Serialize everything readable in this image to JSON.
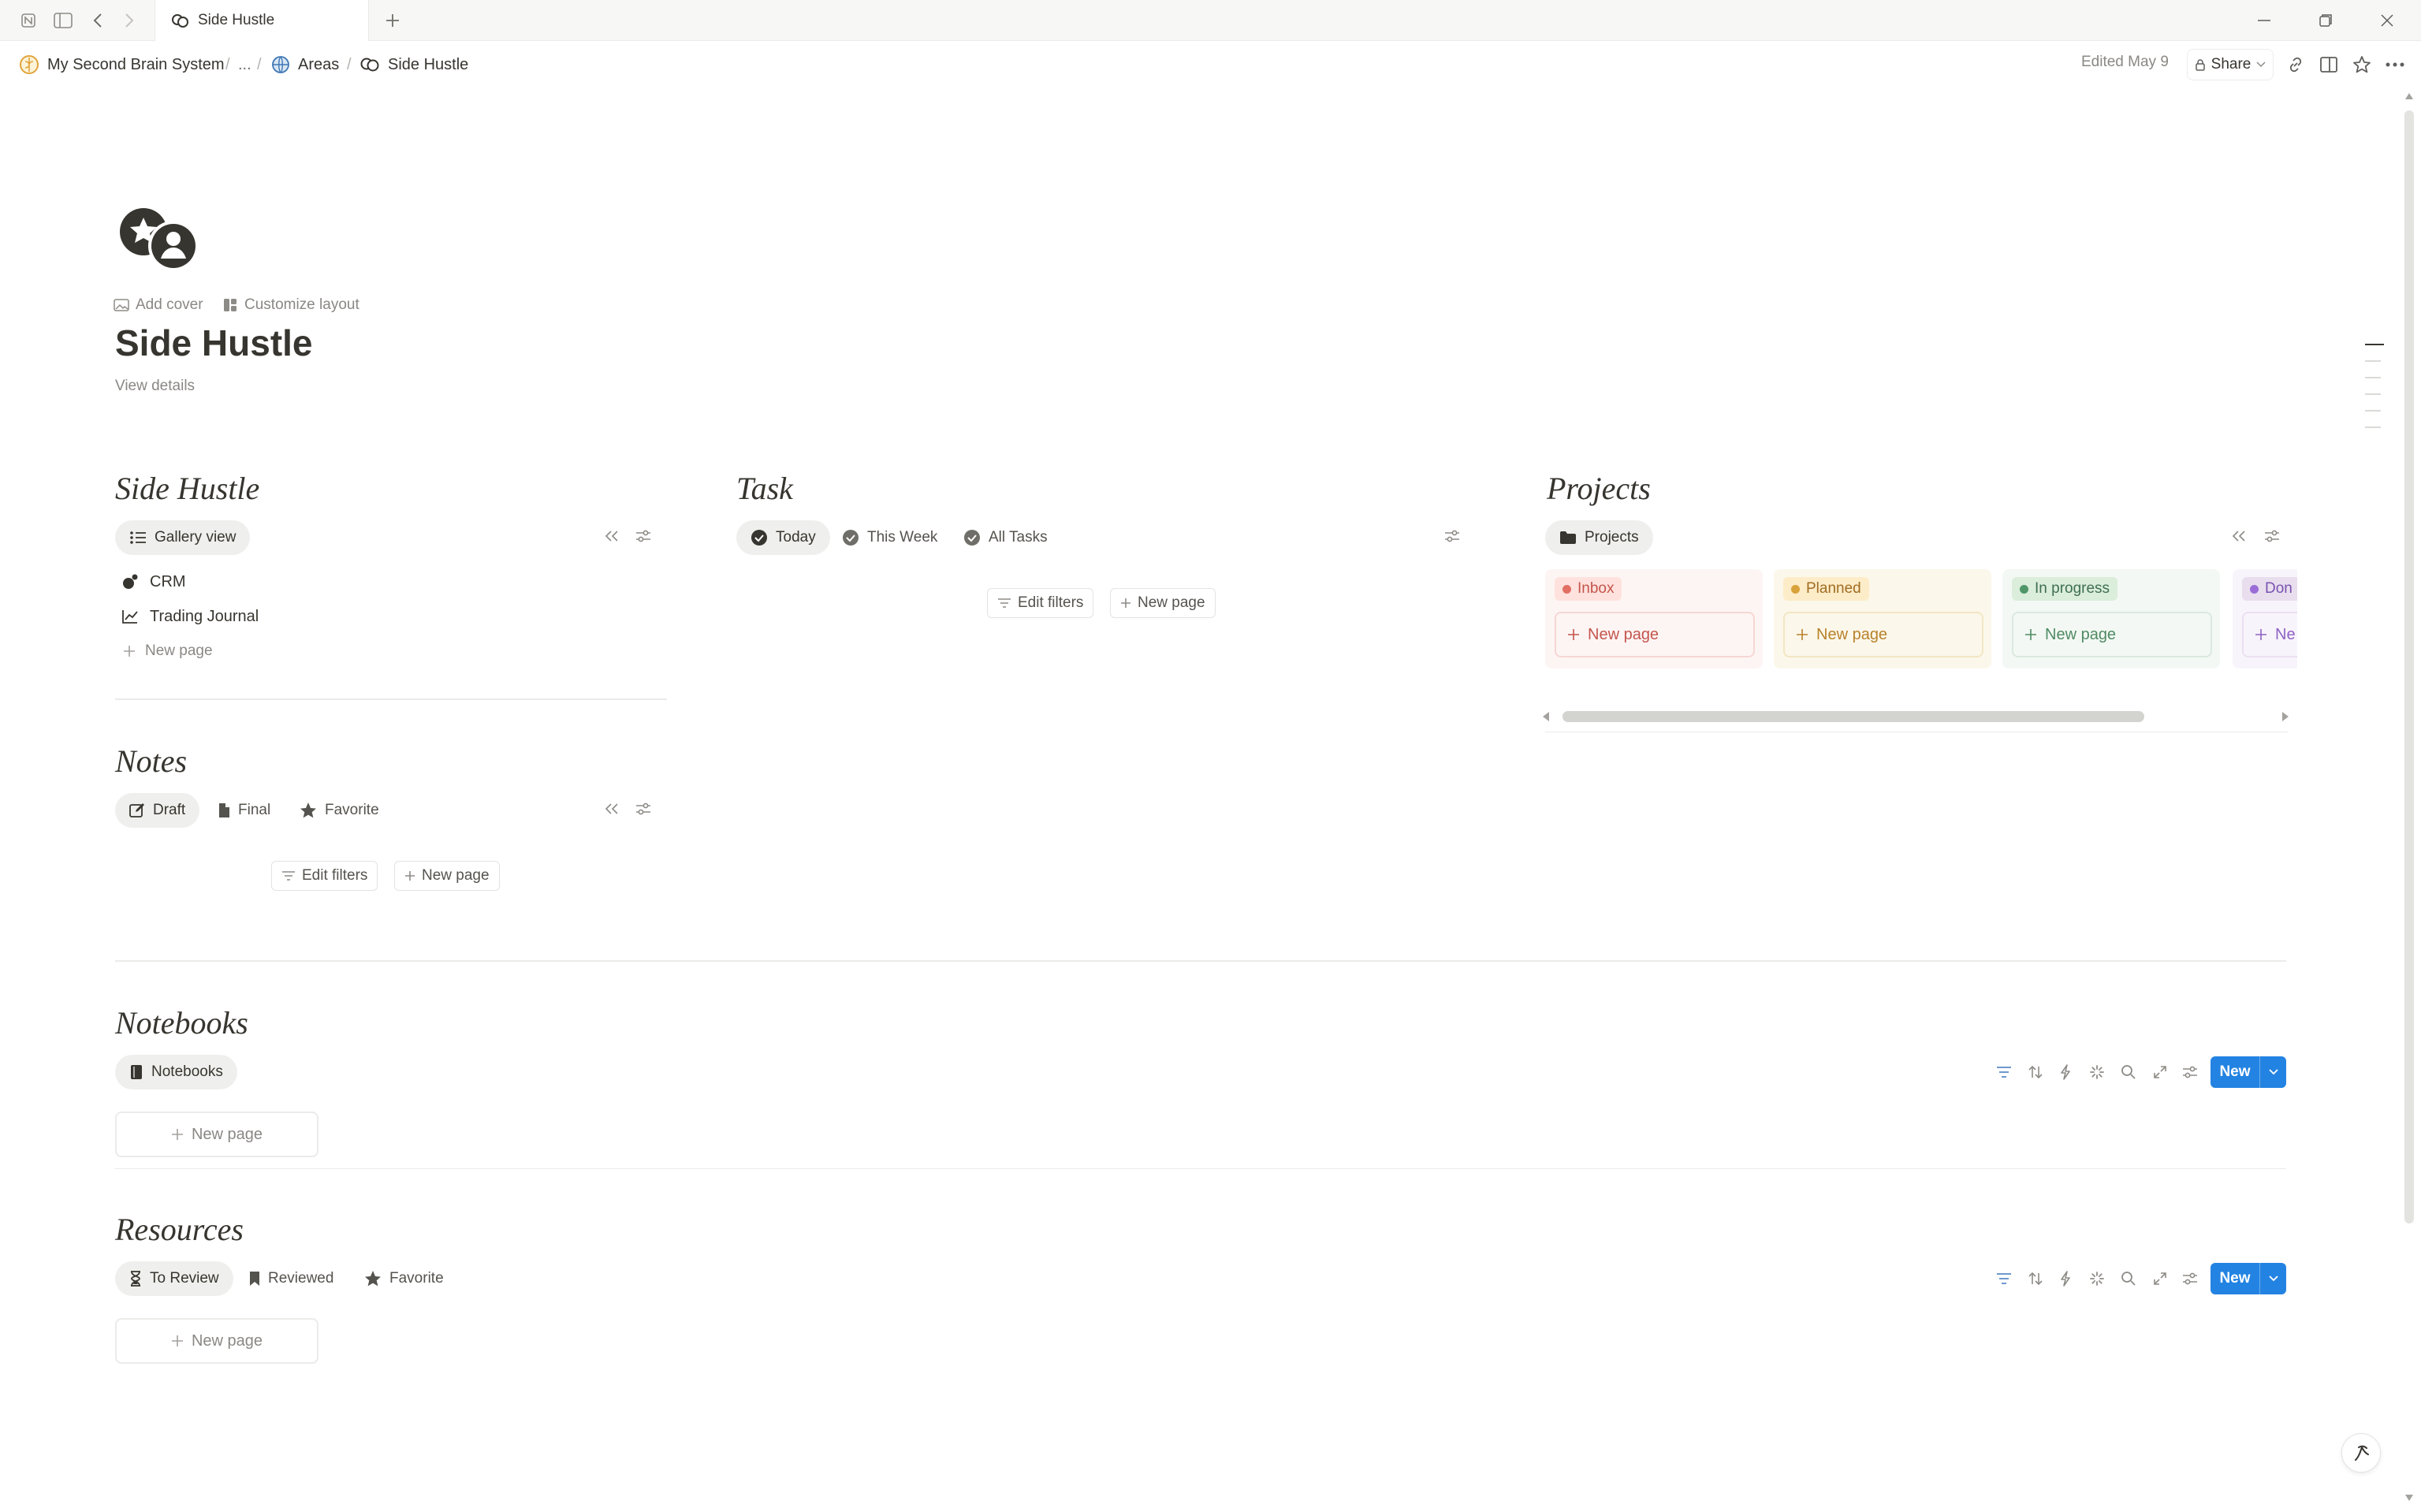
{
  "tab": {
    "title": "Side Hustle"
  },
  "breadcrumb": {
    "items": [
      "My Second Brain System",
      "...",
      "Areas",
      "Side Hustle"
    ],
    "separator": "/"
  },
  "topbar": {
    "edited": "Edited May 9",
    "share": "Share"
  },
  "page": {
    "add_cover": "Add cover",
    "customize_layout": "Customize layout",
    "title": "Side Hustle",
    "view_details": "View details"
  },
  "side_hustle": {
    "title": "Side Hustle",
    "view": "Gallery view",
    "items": [
      "CRM",
      "Trading Journal"
    ],
    "new_page": "New page"
  },
  "task": {
    "title": "Task",
    "tabs": [
      "Today",
      "This Week",
      "All Tasks"
    ],
    "edit_filters": "Edit filters",
    "new_page": "New page"
  },
  "projects": {
    "title": "Projects",
    "view": "Projects",
    "columns": [
      {
        "label": "Inbox",
        "dot": "#e16f64",
        "tag_bg": "#ffe2dd",
        "col_bg": "#fdf5f4",
        "text": "#c4554d"
      },
      {
        "label": "Planned",
        "dot": "#d9a23a",
        "tag_bg": "#fdecc8",
        "col_bg": "#fbf7ea",
        "text": "#b8822b"
      },
      {
        "label": "In progress",
        "dot": "#4f9768",
        "tag_bg": "#dbeddb",
        "col_bg": "#f3f8f4",
        "text": "#4f8a63"
      },
      {
        "label": "Don",
        "dot": "#9a6dd7",
        "tag_bg": "#e8deee",
        "col_bg": "#f8f4fb",
        "text": "#8e62c4"
      }
    ],
    "new_page": "New page",
    "new_page_short": "Ne"
  },
  "notes": {
    "title": "Notes",
    "tabs": [
      "Draft",
      "Final",
      "Favorite"
    ],
    "edit_filters": "Edit filters",
    "new_page": "New page"
  },
  "notebooks": {
    "title": "Notebooks",
    "view": "Notebooks",
    "new_button": "New",
    "new_page": "New page"
  },
  "resources": {
    "title": "Resources",
    "tabs": [
      "To Review",
      "Reviewed",
      "Favorite"
    ],
    "new_button": "New",
    "new_page": "New page"
  },
  "colors": {
    "accent": "#2383e2",
    "text": "#37352f",
    "muted": "#8a8884"
  }
}
